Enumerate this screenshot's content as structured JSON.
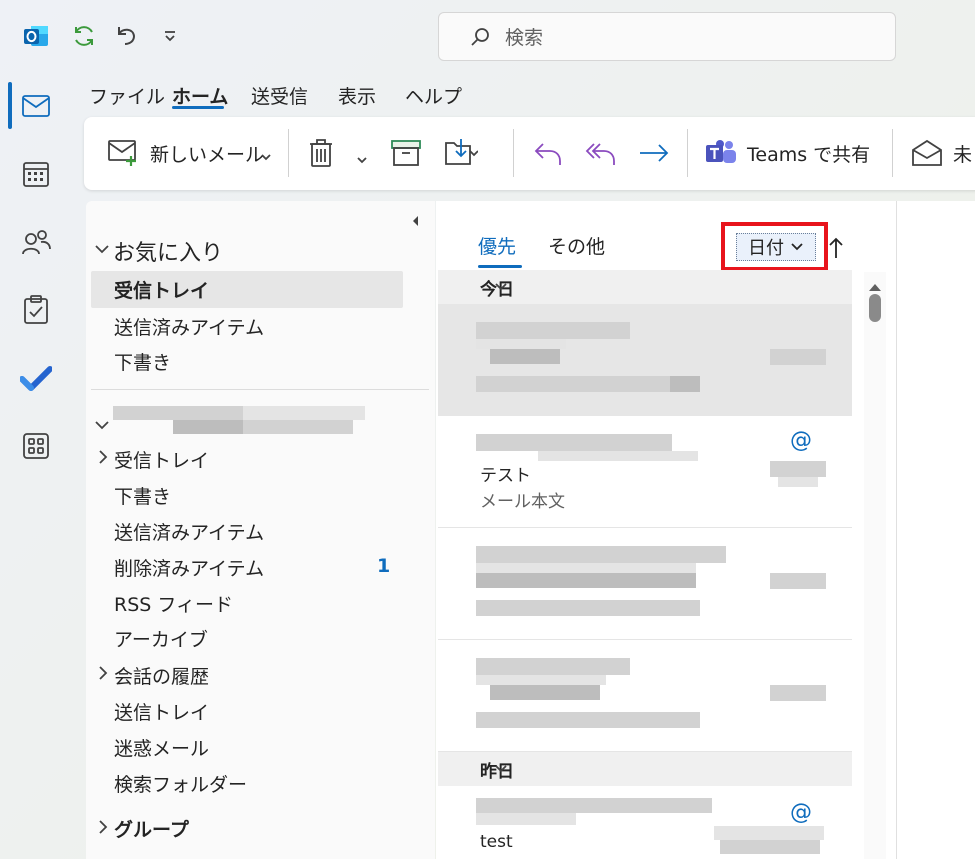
{
  "search": {
    "placeholder": "検索"
  },
  "menu": [
    "ファイル",
    "ホーム",
    "送受信",
    "表示",
    "ヘルプ"
  ],
  "ribbon": {
    "new_mail": "新しいメール",
    "teams_share": "Teams で共有",
    "unread_partial": "未"
  },
  "folders": {
    "favorites_header": "お気に入り",
    "favorites": [
      "受信トレイ",
      "送信済みアイテム",
      "下書き"
    ],
    "account_items": [
      "受信トレイ",
      "下書き",
      "送信済みアイテム",
      "削除済みアイテム",
      "RSS フィード",
      "アーカイブ",
      "会話の履歴",
      "送信トレイ",
      "迷惑メール",
      "検索フォルダー"
    ],
    "deleted_count": "1",
    "groups_header": "グループ"
  },
  "list": {
    "tab_focused": "優先",
    "tab_other": "その他",
    "sort_label": "日付",
    "group_today": "今日",
    "group_yesterday": "昨日",
    "msg2_subject": "テスト",
    "msg2_preview": "メール本文",
    "msg5_subject": "test",
    "mention_symbol": "@"
  },
  "colors": {
    "accent": "#0f6cbd",
    "highlight_box": "#e8141c",
    "reply_purple": "#8b4bbf"
  }
}
